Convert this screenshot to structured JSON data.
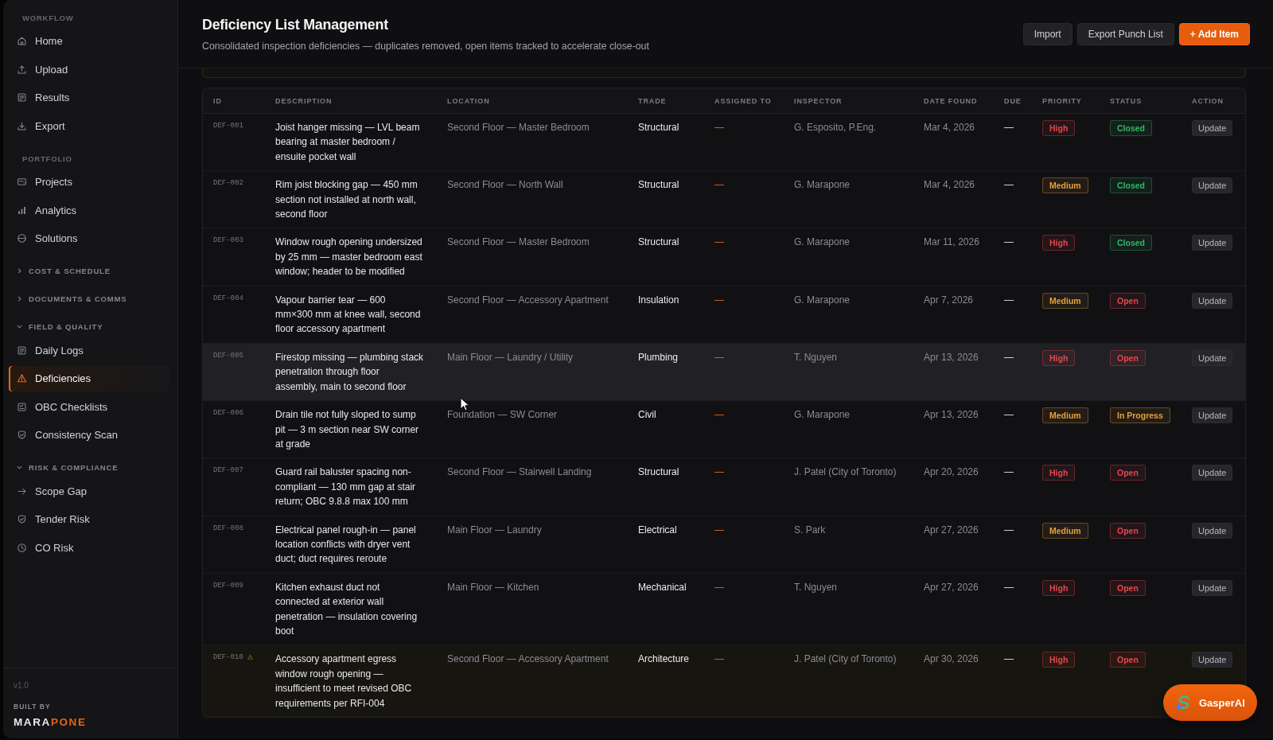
{
  "sidebar": {
    "sections": [
      {
        "kind": "static",
        "label": "WORKFLOW",
        "items": [
          {
            "label": "Home",
            "selected": false
          },
          {
            "label": "Upload",
            "selected": false
          },
          {
            "label": "Results",
            "selected": false
          },
          {
            "label": "Export",
            "selected": false
          }
        ]
      },
      {
        "kind": "static",
        "label": "PORTFOLIO",
        "items": [
          {
            "label": "Projects",
            "selected": false
          },
          {
            "label": "Analytics",
            "selected": false
          },
          {
            "label": "Solutions",
            "selected": false
          }
        ]
      },
      {
        "kind": "group",
        "label": "COST & SCHEDULE",
        "expanded": false
      },
      {
        "kind": "group",
        "label": "DOCUMENTS & COMMS",
        "expanded": false
      },
      {
        "kind": "group",
        "label": "FIELD & QUALITY",
        "expanded": true,
        "items": [
          {
            "label": "Daily Logs",
            "selected": false
          },
          {
            "label": "Deficiencies",
            "selected": true
          },
          {
            "label": "OBC Checklists",
            "selected": false
          },
          {
            "label": "Consistency Scan",
            "selected": false
          }
        ]
      },
      {
        "kind": "group",
        "label": "RISK & COMPLIANCE",
        "expanded": true,
        "items": [
          {
            "label": "Scope Gap",
            "selected": false
          },
          {
            "label": "Tender Risk",
            "selected": false
          },
          {
            "label": "CO Risk",
            "selected": false
          }
        ]
      }
    ],
    "version": "v1.0",
    "built_by": "BUILT BY",
    "brand": "MARAPONE"
  },
  "header": {
    "title": "Deficiency List Management",
    "subtitle": "Consolidated inspection deficiencies — duplicates removed, open items tracked to accelerate close-out",
    "buttons": [
      {
        "label": "Import",
        "kind": "secondary"
      },
      {
        "label": "Export Punch List",
        "kind": "secondary"
      },
      {
        "label": "+ Add Item",
        "kind": "primary"
      }
    ]
  },
  "table": {
    "columns": [
      "ID",
      "DESCRIPTION",
      "LOCATION",
      "TRADE",
      "ASSIGNED TO",
      "INSPECTOR",
      "DATE FOUND",
      "DUE",
      "PRIORITY",
      "STATUS",
      "ACTION"
    ],
    "rows": [
      {
        "id": "DEF-001",
        "flagged": false,
        "highlighted": false,
        "description": "Joist hanger missing — LVL beam bearing at master bedroom / ensuite pocket wall",
        "location": "Second Floor — Master Bedroom",
        "trade": "Structural",
        "assigned_to": "—",
        "inspector": "G. Esposito, P.Eng.",
        "date_found": "Mar 4, 2026",
        "due": "—",
        "priority": {
          "label": "High",
          "color": "#e5484d"
        },
        "status": {
          "label": "Closed",
          "color": "#2fb866"
        },
        "action": "Update"
      },
      {
        "id": "DEF-002",
        "flagged": false,
        "highlighted": false,
        "description": "Rim joist blocking gap — 450 mm section not installed at north wall, second floor",
        "location": "Second Floor — North Wall",
        "trade": "Structural",
        "assigned_to": "—",
        "inspector": "G. Marapone",
        "date_found": "Mar 4, 2026",
        "due": "—",
        "priority": {
          "label": "Medium",
          "color": "#e5a03a"
        },
        "status": {
          "label": "Closed",
          "color": "#2fb866"
        },
        "action": "Update"
      },
      {
        "id": "DEF-003",
        "flagged": false,
        "highlighted": false,
        "description": "Window rough opening undersized by 25 mm — master bedroom east window; header to be modified",
        "location": "Second Floor — Master Bedroom",
        "trade": "Structural",
        "assigned_to": "—",
        "inspector": "G. Marapone",
        "date_found": "Mar 11, 2026",
        "due": "—",
        "priority": {
          "label": "High",
          "color": "#e5484d"
        },
        "status": {
          "label": "Closed",
          "color": "#2fb866"
        },
        "action": "Update"
      },
      {
        "id": "DEF-004",
        "flagged": false,
        "highlighted": false,
        "description": "Vapour barrier tear — 600 mm×300 mm at knee wall, second floor accessory apartment",
        "location": "Second Floor — Accessory Apartment",
        "trade": "Insulation",
        "assigned_to": "—",
        "inspector": "G. Marapone",
        "date_found": "Apr 7, 2026",
        "due": "—",
        "priority": {
          "label": "Medium",
          "color": "#e5a03a"
        },
        "status": {
          "label": "Open",
          "color": "#e5484d"
        },
        "action": "Update"
      },
      {
        "id": "DEF-005",
        "flagged": false,
        "highlighted": true,
        "description": "Firestop missing — plumbing stack penetration through floor assembly, main to second floor",
        "location": "Main Floor — Laundry / Utility",
        "trade": "Plumbing",
        "assigned_to": "—",
        "inspector": "T. Nguyen",
        "date_found": "Apr 13, 2026",
        "due": "—",
        "priority": {
          "label": "High",
          "color": "#e5484d"
        },
        "status": {
          "label": "Open",
          "color": "#e5484d"
        },
        "action": "Update"
      },
      {
        "id": "DEF-006",
        "flagged": false,
        "highlighted": false,
        "description": "Drain tile not fully sloped to sump pit — 3 m section near SW corner at grade",
        "location": "Foundation — SW Corner",
        "trade": "Civil",
        "assigned_to": "—",
        "inspector": "G. Marapone",
        "date_found": "Apr 13, 2026",
        "due": "—",
        "priority": {
          "label": "Medium",
          "color": "#e5a03a"
        },
        "status": {
          "label": "In Progress",
          "color": "#e5a03a"
        },
        "action": "Update"
      },
      {
        "id": "DEF-007",
        "flagged": false,
        "highlighted": false,
        "description": "Guard rail baluster spacing non-compliant — 130 mm gap at stair return; OBC 9.8.8 max 100 mm",
        "location": "Second Floor — Stairwell Landing",
        "trade": "Structural",
        "assigned_to": "—",
        "inspector": "J. Patel (City of Toronto)",
        "date_found": "Apr 20, 2026",
        "due": "—",
        "priority": {
          "label": "High",
          "color": "#e5484d"
        },
        "status": {
          "label": "Open",
          "color": "#e5484d"
        },
        "action": "Update"
      },
      {
        "id": "DEF-008",
        "flagged": false,
        "highlighted": false,
        "description": "Electrical panel rough-in — panel location conflicts with dryer vent duct; duct requires reroute",
        "location": "Main Floor — Laundry",
        "trade": "Electrical",
        "assigned_to": "—",
        "inspector": "S. Park",
        "date_found": "Apr 27, 2026",
        "due": "—",
        "priority": {
          "label": "Medium",
          "color": "#e5a03a"
        },
        "status": {
          "label": "Open",
          "color": "#e5484d"
        },
        "action": "Update"
      },
      {
        "id": "DEF-009",
        "flagged": false,
        "highlighted": false,
        "description": "Kitchen exhaust duct not connected at exterior wall penetration — insulation covering boot",
        "location": "Main Floor — Kitchen",
        "trade": "Mechanical",
        "assigned_to": "—",
        "inspector": "T. Nguyen",
        "date_found": "Apr 27, 2026",
        "due": "—",
        "priority": {
          "label": "High",
          "color": "#e5484d"
        },
        "status": {
          "label": "Open",
          "color": "#e5484d"
        },
        "action": "Update"
      },
      {
        "id": "DEF-010",
        "flagged": true,
        "highlighted": false,
        "description": "Accessory apartment egress window rough opening — insufficient to meet revised OBC requirements per RFI-004",
        "location": "Second Floor — Accessory Apartment",
        "trade": "Architecture",
        "assigned_to": "—",
        "inspector": "J. Patel (City of Toronto)",
        "date_found": "Apr 30, 2026",
        "due": "—",
        "priority": {
          "label": "High",
          "color": "#e5484d"
        },
        "status": {
          "label": "Open",
          "color": "#e5484d"
        },
        "action": "Update"
      }
    ]
  },
  "assistant_button": {
    "label": "GasperAI"
  }
}
